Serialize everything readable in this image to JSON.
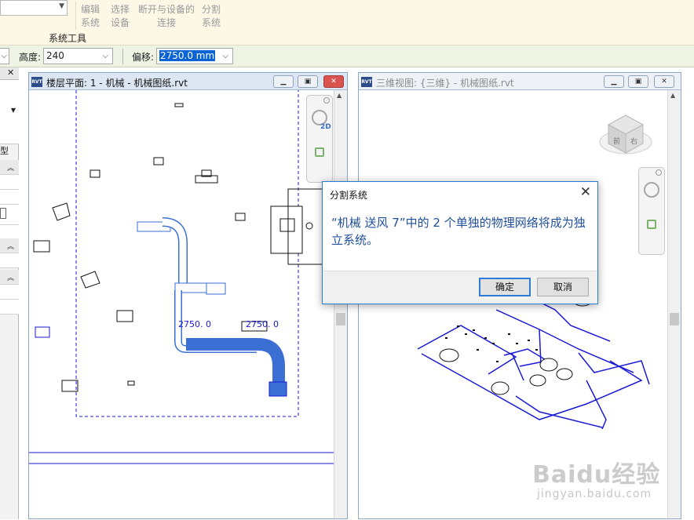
{
  "ribbon": {
    "buttons": [
      {
        "line1": "编辑",
        "line2": "系统"
      },
      {
        "line1": "选择",
        "line2": "设备"
      },
      {
        "line1": "断开与设备的",
        "line2": "连接"
      },
      {
        "line1": "分割",
        "line2": "系统"
      }
    ],
    "panel_label": "系统工具"
  },
  "options_bar": {
    "height_label": "高度:",
    "height_value": "240",
    "offset_label": "偏移:",
    "offset_value": "2750.0 mm"
  },
  "left_panel": {
    "header_text": "型",
    "close_glyph": "✕"
  },
  "plan_view": {
    "title": "楼层平面: 1 - 机械 - 机械图纸.rvt",
    "dim_label_1": "2750. 0",
    "dim_label_2": "2750. 0",
    "icon": "rvt-file-icon"
  },
  "view_3d": {
    "title": "三维视图: {三维} - 机械图纸.rvt",
    "viewcube_label": "前",
    "viewcube_label_2": "右",
    "icon": "rvt-file-icon"
  },
  "window_buttons": {
    "minimize": "▁",
    "restore": "▣",
    "close": "✕"
  },
  "navbar": {
    "twod_label": "2D"
  },
  "dialog": {
    "title": "分割系统",
    "message": "“机械 送风 7”中的 2 个单独的物理网络将成为独立系统。",
    "ok_label": "确定",
    "cancel_label": "取消"
  },
  "watermark": {
    "logo": "Baidu经验",
    "url": "jingyan.baidu.com"
  },
  "colors": {
    "duct_blue": "#3b6fd4",
    "line_blue": "#1a1ad6",
    "dialog_text": "#1f4e9c",
    "selection": "#0a64d6"
  }
}
